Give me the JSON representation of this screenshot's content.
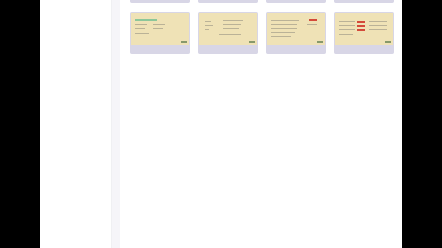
{
  "cards": [
    {
      "thumb_title": "",
      "caption": ""
    },
    {
      "thumb_title": "",
      "caption": ""
    },
    {
      "thumb_title": "",
      "caption": ""
    },
    {
      "thumb_title": "",
      "caption": ""
    }
  ],
  "colors": {
    "card_frame": "#d8d6e6",
    "thumb_bg": "#efe2b6"
  }
}
